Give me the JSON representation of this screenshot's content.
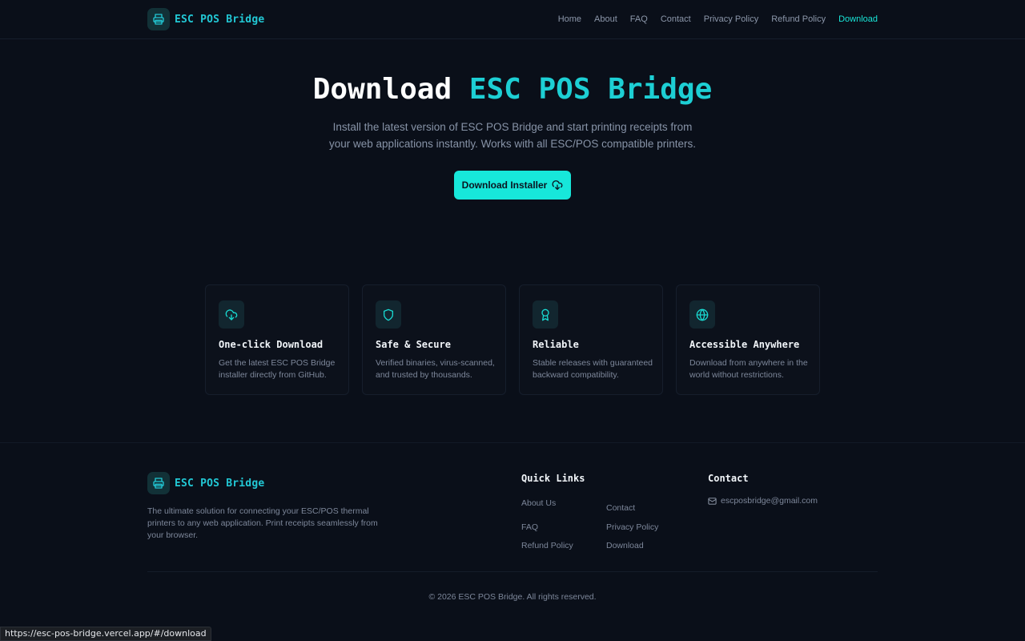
{
  "brand": {
    "name": "ESC POS Bridge",
    "icon": "printer-icon",
    "accent": "#22c8d5"
  },
  "nav": {
    "items": [
      "Home",
      "About",
      "FAQ",
      "Contact",
      "Privacy Policy",
      "Refund Policy",
      "Download"
    ],
    "active": "Download"
  },
  "hero": {
    "title_prefix": "Download",
    "title_accent": "ESC POS Bridge",
    "subtitle": "Install the latest version of ESC POS Bridge and start printing receipts from your web applications instantly. Works with all ESC/POS compatible printers.",
    "button_label": "Download Installer",
    "button_icon": "cloud-download-icon",
    "button_color": "#17e7da"
  },
  "features": [
    {
      "icon": "cloud-download-icon",
      "title": "One-click Download",
      "desc": "Get the latest ESC POS Bridge installer directly from GitHub."
    },
    {
      "icon": "shield-icon",
      "title": "Safe & Secure",
      "desc": "Verified binaries, virus-scanned, and trusted by thousands."
    },
    {
      "icon": "award-icon",
      "title": "Reliable",
      "desc": "Stable releases with guaranteed backward compatibility."
    },
    {
      "icon": "globe-icon",
      "title": "Accessible Anywhere",
      "desc": "Download from anywhere in the world without restrictions."
    }
  ],
  "footer": {
    "brand_name": "ESC POS Bridge",
    "description": "The ultimate solution for connecting your ESC/POS thermal printers to any web application. Print receipts seamlessly from your browser.",
    "quick_links_heading": "Quick Links",
    "quick_links": [
      "About Us",
      "Contact",
      "FAQ",
      "Privacy Policy",
      "Refund Policy",
      "Download"
    ],
    "contact_heading": "Contact",
    "email": "escposbridge@gmail.com",
    "copyright": "© 2026 ESC POS Bridge. All rights reserved."
  },
  "status_bar": {
    "url": "https://esc-pos-bridge.vercel.app/#/download"
  }
}
